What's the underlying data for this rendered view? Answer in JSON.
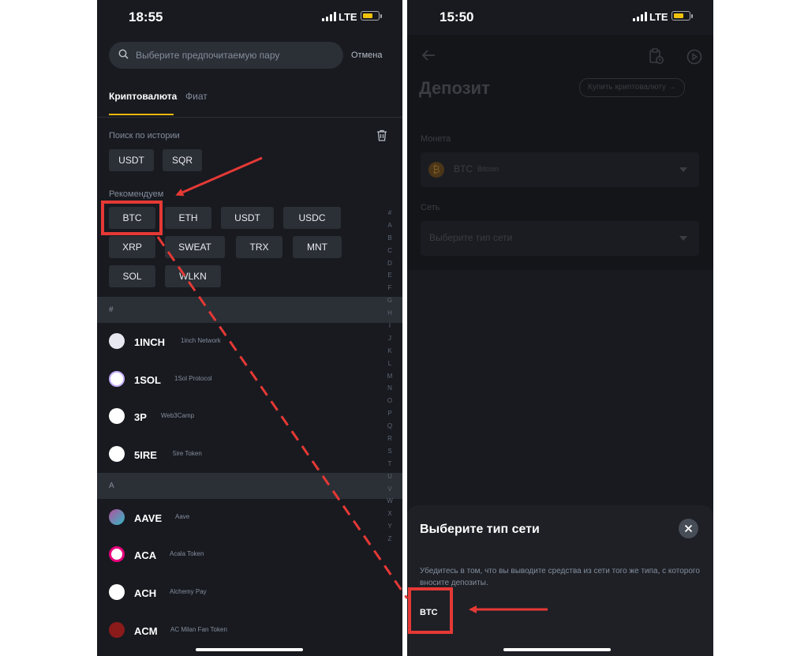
{
  "left": {
    "time": "18:55",
    "network": "LTE",
    "search_placeholder": "Выберите предпочитаемую пару",
    "cancel_label": "Отмена",
    "tabs": [
      "Криптовалюта",
      "Фиат"
    ],
    "history_label": "Поиск по истории",
    "history_chips": [
      "USDT",
      "SQR"
    ],
    "recommended_label": "Рекомендуем",
    "recommended_chips": [
      "BTC",
      "ETH",
      "USDT",
      "USDC",
      "XRP",
      "SWEAT",
      "TRX",
      "MNT",
      "SOL",
      "WLKN"
    ],
    "sections": [
      "#",
      "A"
    ],
    "coins_hash": [
      {
        "symbol": "1INCH",
        "name": "1inch Network",
        "icon": "1inch-unicorn-icon"
      },
      {
        "symbol": "1SOL",
        "name": "1Sol Protocol",
        "icon": "1sol-icon"
      },
      {
        "symbol": "3P",
        "name": "Web3Camp",
        "icon": "3p-icon"
      },
      {
        "symbol": "5IRE",
        "name": "5ire Token",
        "icon": "5ire-icon"
      }
    ],
    "coins_a": [
      {
        "symbol": "AAVE",
        "name": "Aave",
        "icon": "aave-icon"
      },
      {
        "symbol": "ACA",
        "name": "Acala Token",
        "icon": "acala-icon"
      },
      {
        "symbol": "ACH",
        "name": "Alchemy Pay",
        "icon": "alchemy-icon"
      },
      {
        "symbol": "ACM",
        "name": "AC Milan Fan Token",
        "icon": "ac-milan-icon"
      }
    ],
    "alphabet": [
      "#",
      "A",
      "B",
      "C",
      "D",
      "E",
      "F",
      "G",
      "H",
      "I",
      "J",
      "K",
      "L",
      "M",
      "N",
      "O",
      "P",
      "Q",
      "R",
      "S",
      "T",
      "U",
      "V",
      "W",
      "X",
      "Y",
      "Z"
    ]
  },
  "right": {
    "time": "15:50",
    "network": "LTE",
    "title": "Депозит",
    "buy_button": "Купить криптовалюту",
    "coin_label": "Монета",
    "coin_value": "BTC",
    "coin_name": "Bitcoin",
    "network_label": "Сеть",
    "network_placeholder": "Выберите тип сети",
    "sheet_title": "Выберите тип сети",
    "sheet_note": "Убедитесь в том, что вы выводите средства из сети того же типа, с которого вносите депозиты.",
    "sheet_option": "BTC"
  },
  "colors": {
    "background": "#181a20",
    "chip": "#2b2f36",
    "accent": "#f0b90b",
    "highlight": "#e53935"
  }
}
